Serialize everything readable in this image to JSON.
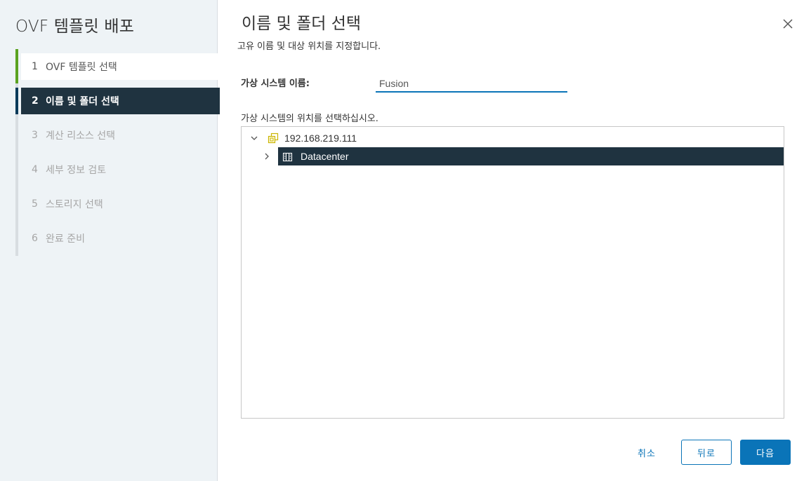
{
  "wizard": {
    "title": "OVF 템플릿 배포",
    "steps": [
      {
        "num": "1",
        "label": "OVF 템플릿 선택",
        "state": "complete"
      },
      {
        "num": "2",
        "label": "이름 및 폴더 선택",
        "state": "current"
      },
      {
        "num": "3",
        "label": "계산 리소스 선택",
        "state": "pending"
      },
      {
        "num": "4",
        "label": "세부 정보 검토",
        "state": "pending"
      },
      {
        "num": "5",
        "label": "스토리지 선택",
        "state": "pending"
      },
      {
        "num": "6",
        "label": "완료 준비",
        "state": "pending"
      }
    ]
  },
  "page": {
    "title": "이름 및 폴더 선택",
    "subtitle": "고유 이름 및 대상 위치를 지정합니다.",
    "vm_name_label": "가상 시스템 이름:",
    "vm_name_value": "Fusion",
    "location_label": "가상 시스템의 위치를 선택하십시오."
  },
  "tree": {
    "root": {
      "label": "192.168.219.111",
      "icon": "vcenter-icon",
      "expanded": true
    },
    "children": [
      {
        "label": "Datacenter",
        "icon": "datacenter-icon",
        "expanded": false,
        "selected": true
      }
    ]
  },
  "footer": {
    "cancel_label": "취소",
    "back_label": "뒤로",
    "next_label": "다음"
  },
  "colors": {
    "accent": "#0a74b8",
    "selected_bg": "#1f3340",
    "complete_bar": "#5aa220",
    "nav_bg": "#eef3f6"
  }
}
